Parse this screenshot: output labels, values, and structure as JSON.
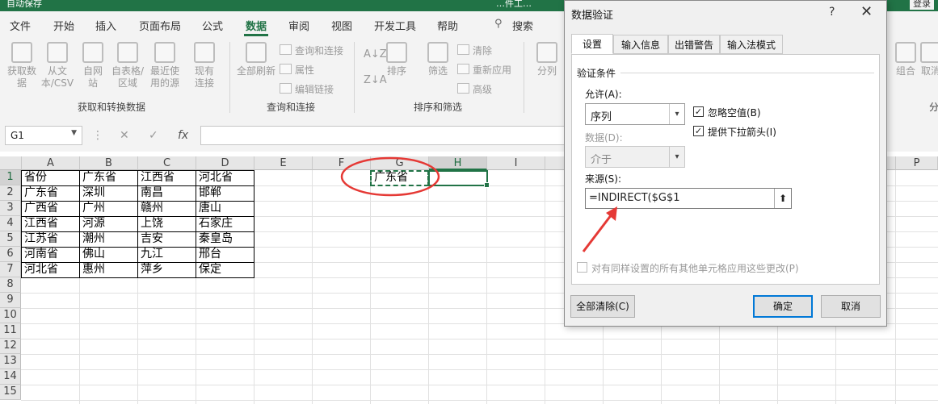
{
  "window": {
    "left_title": "自动保存",
    "doc_title": "…件工…",
    "login": "登录"
  },
  "menu": [
    "文件",
    "开始",
    "插入",
    "页面布局",
    "公式",
    "数据",
    "审阅",
    "视图",
    "开发工具",
    "帮助"
  ],
  "menu_active": "数据",
  "search_label": "搜索",
  "ribbon": {
    "get_from_data": "获取数据",
    "from_csv": "从文本/CSV",
    "from_web": "自网站",
    "from_table": "自表格/区域",
    "recent": "最近使用的源",
    "existing": "现有连接",
    "refresh_all": "全部刷新",
    "queries": "查询和连接",
    "properties": "属性",
    "edit_links": "编辑链接",
    "sort": "排序",
    "filter": "筛选",
    "clear": "清除",
    "reapply": "重新应用",
    "advanced": "高级",
    "split": "分列",
    "group": "组合",
    "ungroup": "取消",
    "group_labels": [
      "获取和转换数据",
      "查询和连接",
      "排序和筛选",
      "分"
    ]
  },
  "name_box": "G1",
  "formula_fx": "fx",
  "columns": [
    "A",
    "B",
    "C",
    "D",
    "E",
    "F",
    "G",
    "H",
    "I",
    "P"
  ],
  "rows": [
    "1",
    "2",
    "3",
    "4",
    "5",
    "6",
    "7",
    "8",
    "9",
    "10",
    "11",
    "12",
    "13",
    "14",
    "15"
  ],
  "table": [
    [
      "省份",
      "广东省",
      "江西省",
      "河北省"
    ],
    [
      "广东省",
      "深圳",
      "南昌",
      "邯郸"
    ],
    [
      "广西省",
      "广州",
      "赣州",
      "唐山"
    ],
    [
      "江西省",
      "河源",
      "上饶",
      "石家庄"
    ],
    [
      "江苏省",
      "潮州",
      "吉安",
      "秦皇岛"
    ],
    [
      "河南省",
      "佛山",
      "九江",
      "邢台"
    ],
    [
      "河北省",
      "惠州",
      "萍乡",
      "保定"
    ]
  ],
  "g1_value": "广东省",
  "dialog": {
    "title": "数据验证",
    "help": "?",
    "close": "✕",
    "tabs": [
      "设置",
      "输入信息",
      "出错警告",
      "输入法模式"
    ],
    "section": "验证条件",
    "allow_label": "允许(A):",
    "allow_value": "序列",
    "ignore_blank": "忽略空值(B)",
    "dropdown": "提供下拉箭头(I)",
    "data_label": "数据(D):",
    "data_value": "介于",
    "source_label": "来源(S):",
    "source_value": "=INDIRECT($G$1",
    "apply_all": "对有同样设置的所有其他单元格应用这些更改(P)",
    "clear_all": "全部清除(C)",
    "ok": "确定",
    "cancel": "取消"
  },
  "annotation_color": "#e53935",
  "accent": "#217346"
}
